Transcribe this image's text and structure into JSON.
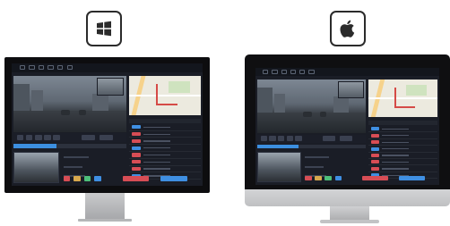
{
  "os": {
    "windows_icon": "windows-logo-icon",
    "apple_icon": "apple-logo-icon"
  },
  "app": {
    "playback_progress": 0.38,
    "list_rows": [
      {
        "tag_color": "#3f8fe2"
      },
      {
        "tag_color": "#d74d55"
      },
      {
        "tag_color": "#d74d55"
      },
      {
        "tag_color": "#3f8fe2"
      },
      {
        "tag_color": "#d74d55"
      },
      {
        "tag_color": "#d74d55"
      },
      {
        "tag_color": "#d74d55"
      },
      {
        "tag_color": "#3f8fe2"
      }
    ],
    "accent_blue": "#3f8fe2",
    "accent_red": "#d74d55",
    "background": "#1a1d26"
  }
}
